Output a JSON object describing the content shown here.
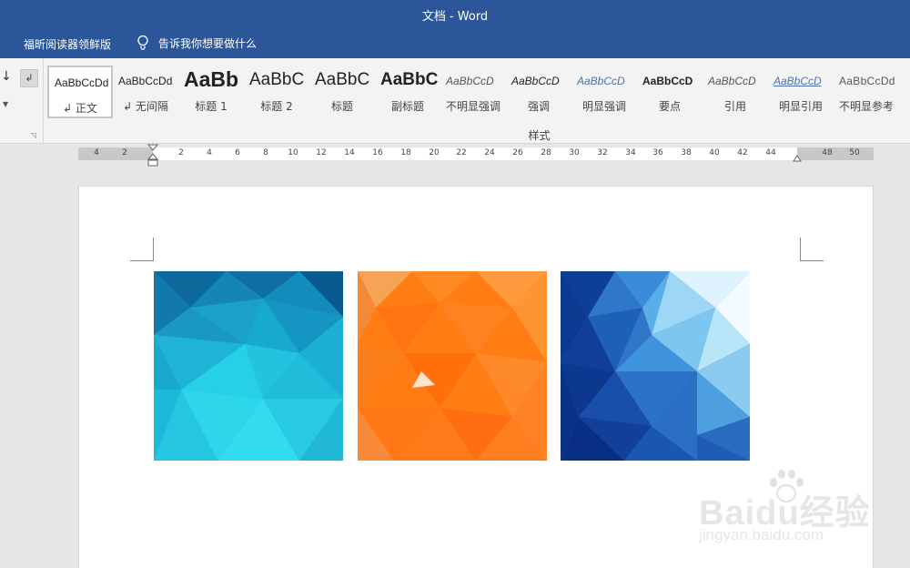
{
  "window": {
    "title": "文档  -  Word"
  },
  "tellbar": {
    "addin_label": "福昕阅读器领鲜版",
    "tell_me_label": "告诉我你想要做什么"
  },
  "ribbon": {
    "para_mark": "↲",
    "styles_group_label": "样式",
    "styles": [
      {
        "sample": "AaBbCcDd",
        "label": "↲ 正文",
        "selected": true
      },
      {
        "sample": "AaBbCcDd",
        "label": "↲ 无间隔"
      },
      {
        "sample": "AaBb",
        "label": "标题 1"
      },
      {
        "sample": "AaBbC",
        "label": "标题 2"
      },
      {
        "sample": "AaBbC",
        "label": "标题"
      },
      {
        "sample": "AaBbC",
        "label": "副标题"
      },
      {
        "sample": "AaBbCcD",
        "label": "不明显强调"
      },
      {
        "sample": "AaBbCcD",
        "label": "强调"
      },
      {
        "sample": "AaBbCcD",
        "label": "明显强调"
      },
      {
        "sample": "AaBbCcD",
        "label": "要点"
      },
      {
        "sample": "AaBbCcD",
        "label": "引用"
      },
      {
        "sample": "AaBbCcD",
        "label": "明显引用"
      },
      {
        "sample": "AaBbCcDd",
        "label": "不明显参考"
      }
    ]
  },
  "ruler": {
    "labels": [
      "4",
      "2",
      "2",
      "4",
      "6",
      "8",
      "10",
      "12",
      "14",
      "16",
      "18",
      "20",
      "22",
      "24",
      "26",
      "28",
      "30",
      "32",
      "34",
      "36",
      "38",
      "40",
      "42",
      "44",
      "48",
      "50"
    ]
  },
  "document": {
    "images": [
      {
        "name": "teal-lowpoly-image",
        "colors": [
          "#0b5f8e",
          "#1ec8d9"
        ]
      },
      {
        "name": "orange-lowpoly-image",
        "colors": [
          "#ff7a10",
          "#f59b3a"
        ]
      },
      {
        "name": "blue-lowpoly-image",
        "colors": [
          "#072f86",
          "#e8f6ff"
        ]
      }
    ]
  },
  "watermark": {
    "brand": "Baidu经验",
    "url": "jingyan.baidu.com"
  },
  "colors": {
    "accent": "#2b579a",
    "ribbon_bg": "#f3f3f3",
    "page_bg": "#ffffff"
  }
}
